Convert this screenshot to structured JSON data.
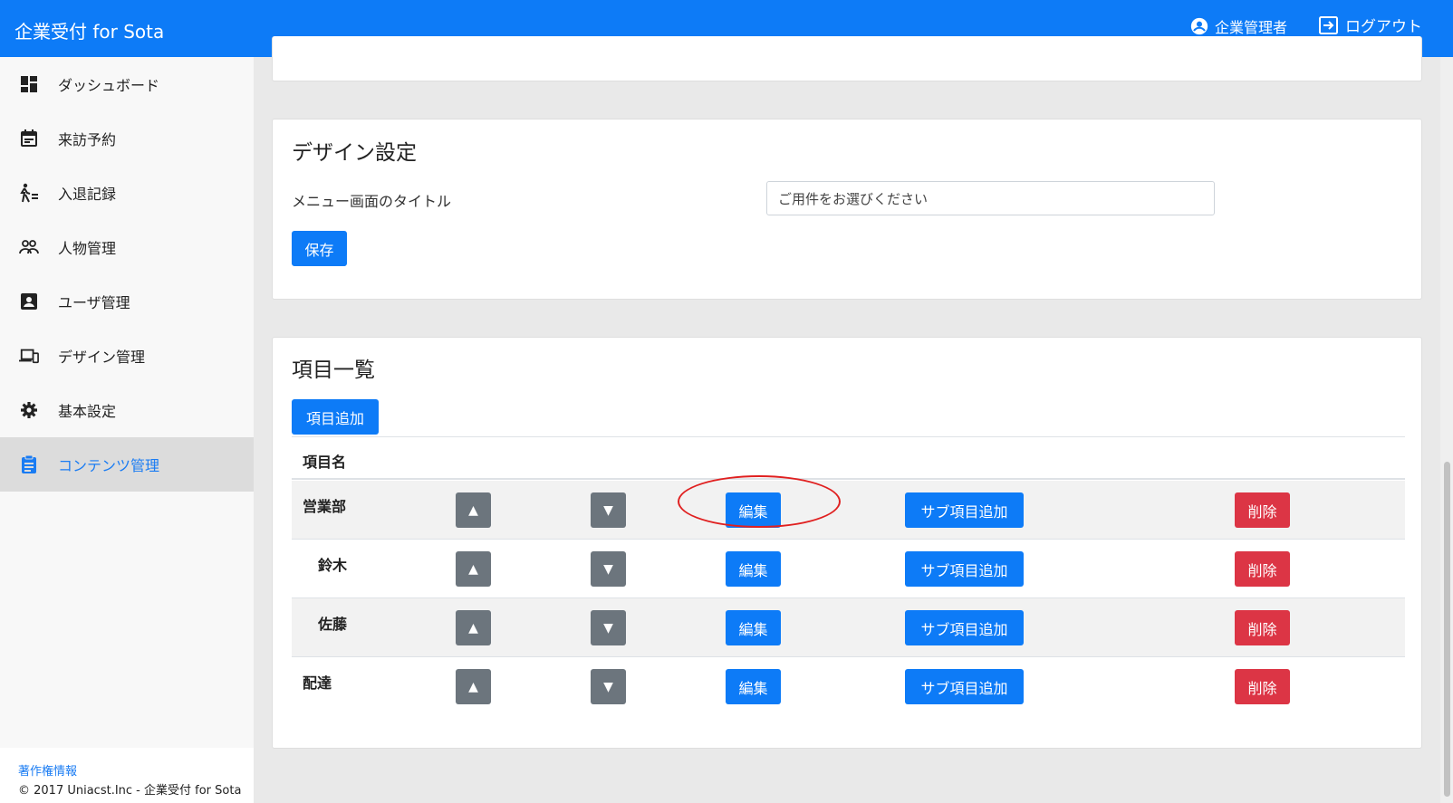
{
  "header": {
    "title": "企業受付 for Sota",
    "user_label": "企業管理者",
    "logout_label": "ログアウト"
  },
  "sidebar": {
    "items": [
      {
        "label": "ダッシュボード",
        "icon": "dashboard-icon"
      },
      {
        "label": "来訪予約",
        "icon": "calendar-icon"
      },
      {
        "label": "入退記録",
        "icon": "walk-icon"
      },
      {
        "label": "人物管理",
        "icon": "people-icon"
      },
      {
        "label": "ユーザ管理",
        "icon": "account-box-icon"
      },
      {
        "label": "デザイン管理",
        "icon": "devices-icon"
      },
      {
        "label": "基本設定",
        "icon": "gear-icon"
      },
      {
        "label": "コンテンツ管理",
        "icon": "clipboard-icon",
        "active": true
      }
    ],
    "footer": {
      "link": "著作権情報",
      "copyright": "© 2017 Uniacst.Inc - 企業受付 for Sota"
    }
  },
  "design_settings": {
    "title": "デザイン設定",
    "menu_title_label": "メニュー画面のタイトル",
    "menu_title_value": "ご用件をお選びください",
    "save_label": "保存"
  },
  "items_list": {
    "title": "項目一覧",
    "add_label": "項目追加",
    "column_name": "項目名",
    "up_symbol": "▲",
    "down_symbol": "▼",
    "edit_label": "編集",
    "add_sub_label": "サブ項目追加",
    "delete_label": "削除",
    "rows": [
      {
        "name": "営業部",
        "level": 0
      },
      {
        "name": "鈴木",
        "level": 1
      },
      {
        "name": "佐藤",
        "level": 1
      },
      {
        "name": "配達",
        "level": 0
      }
    ]
  },
  "colors": {
    "primary": "#0d7bf7",
    "danger": "#dc3545",
    "secondary": "#6c757d",
    "annotation": "#e02020"
  }
}
